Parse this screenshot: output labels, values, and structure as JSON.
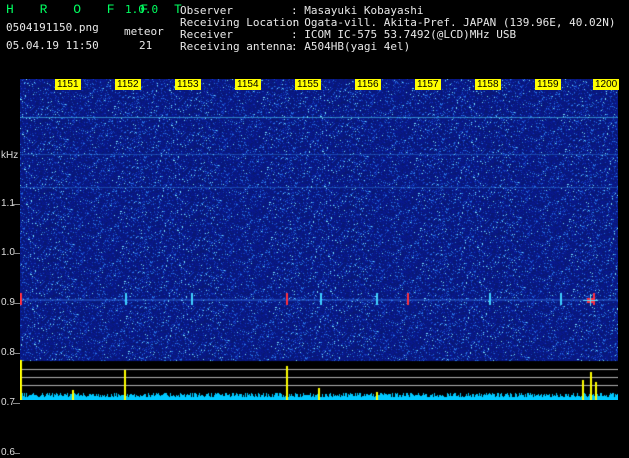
{
  "app": {
    "name": "H R O F F T",
    "version": "1.0.0"
  },
  "file": {
    "name": "0504191150.png",
    "datetime": "05.04.19 11:50"
  },
  "meteor": {
    "label": "meteor",
    "count": "21"
  },
  "info": [
    {
      "label": "Observer",
      "value": ": Masayuki Kobayashi"
    },
    {
      "label": "Receiving Location",
      "value": ": Ogata-vill. Akita-Pref. JAPAN (139.96E, 40.02N)"
    },
    {
      "label": "Receiver",
      "value": ": ICOM IC-575 53.7492(@LCD)MHz USB"
    },
    {
      "label": "Receiving antenna",
      "value": ": A504HB(yagi 4el)"
    }
  ],
  "axis": {
    "unit": "kHz",
    "y_labels": [
      "1.1",
      "1.0",
      "0.9",
      "0.8",
      "0.7",
      "0.6"
    ],
    "minute_labels": [
      "1151",
      "1152",
      "1153",
      "1154",
      "1155",
      "1156",
      "1157",
      "1158",
      "1159",
      "1200"
    ]
  },
  "colors": {
    "background": "#0a1a7a",
    "accent": "#00ff60",
    "label_bg": "#ffff00",
    "signal": "#ff3040",
    "bars": "#ffff00",
    "noise_floor": "#00c8ff"
  }
}
